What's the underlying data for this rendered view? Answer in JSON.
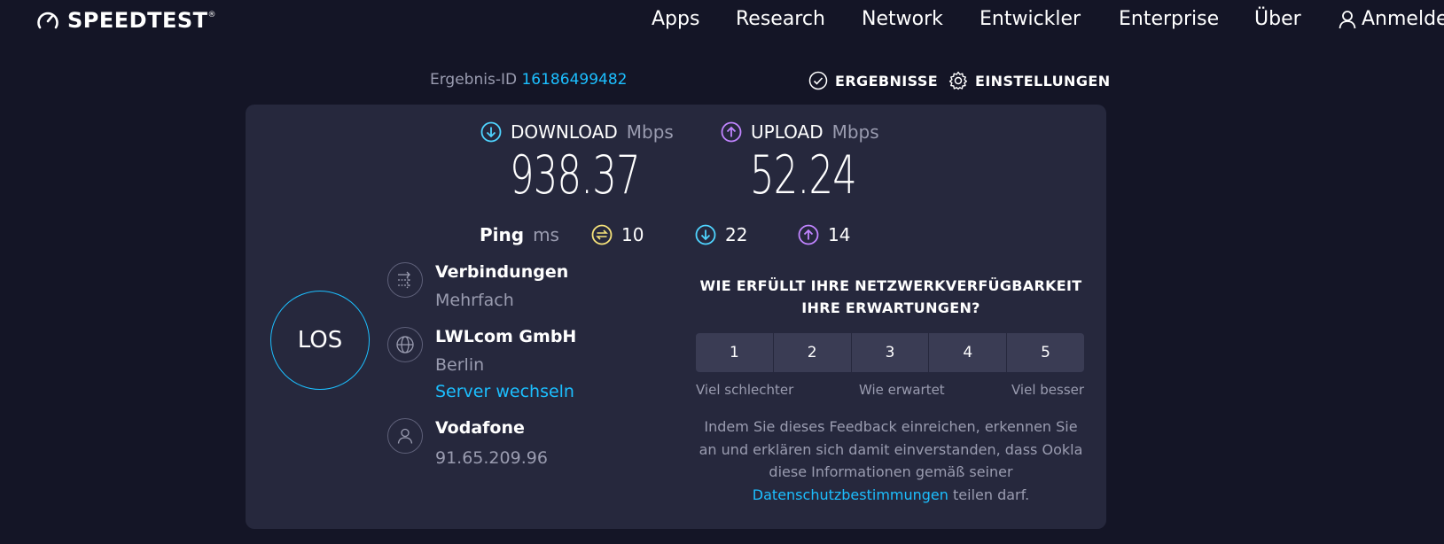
{
  "header": {
    "logo_text": "SPEEDTEST",
    "logo_mark": "®",
    "nav": [
      "Apps",
      "Research",
      "Network",
      "Entwickler",
      "Enterprise",
      "Über"
    ],
    "login_label": "Anmelden"
  },
  "result": {
    "id_label": "Ergebnis-ID",
    "id_value": "16186499482",
    "results_label": "ERGEBNISSE",
    "settings_label": "EINSTELLUNGEN"
  },
  "download": {
    "label": "DOWNLOAD",
    "unit": "Mbps",
    "value": "938.37"
  },
  "upload": {
    "label": "UPLOAD",
    "unit": "Mbps",
    "value": "52.24"
  },
  "ping": {
    "label": "Ping",
    "unit": "ms",
    "idle": "10",
    "download": "22",
    "upload": "14"
  },
  "go_label": "LOS",
  "connection": {
    "title": "Verbindungen",
    "value": "Mehrfach"
  },
  "server": {
    "name": "LWLcom GmbH",
    "city": "Berlin",
    "change_label": "Server wechseln"
  },
  "provider": {
    "name": "Vodafone",
    "ip": "91.65.209.96"
  },
  "survey": {
    "question_line1": "WIE ERFÜLLT IHRE NETZWERKVERFÜGBARKEIT",
    "question_line2": "IHRE ERWARTUNGEN?",
    "options": [
      "1",
      "2",
      "3",
      "4",
      "5"
    ],
    "scale_low": "Viel schlechter",
    "scale_mid": "Wie erwartet",
    "scale_high": "Viel besser",
    "disclaimer_text": "Indem Sie dieses Feedback einreichen, erkennen Sie an und erklären sich damit einverstanden, dass Ookla diese Informationen gemäß seiner ",
    "disclaimer_link": "Datenschutzbestimmungen",
    "disclaimer_end": " teilen darf."
  },
  "colors": {
    "background": "#141526",
    "card": "#26283d",
    "accent_cyan": "#1cbfff",
    "download_icon": "#4fd4ff",
    "upload_icon": "#c084ff",
    "ping_icon": "#f5e27a",
    "muted_text": "#9a9cb0"
  },
  "icons": {
    "logo": "speedometer-icon",
    "login": "user-icon",
    "results": "check-circle-icon",
    "settings": "gear-icon",
    "download": "arrow-down-circle-icon",
    "upload": "arrow-up-circle-icon",
    "ping": "ping-icon",
    "connections": "connections-icon",
    "server": "globe-icon",
    "provider": "user-icon"
  }
}
